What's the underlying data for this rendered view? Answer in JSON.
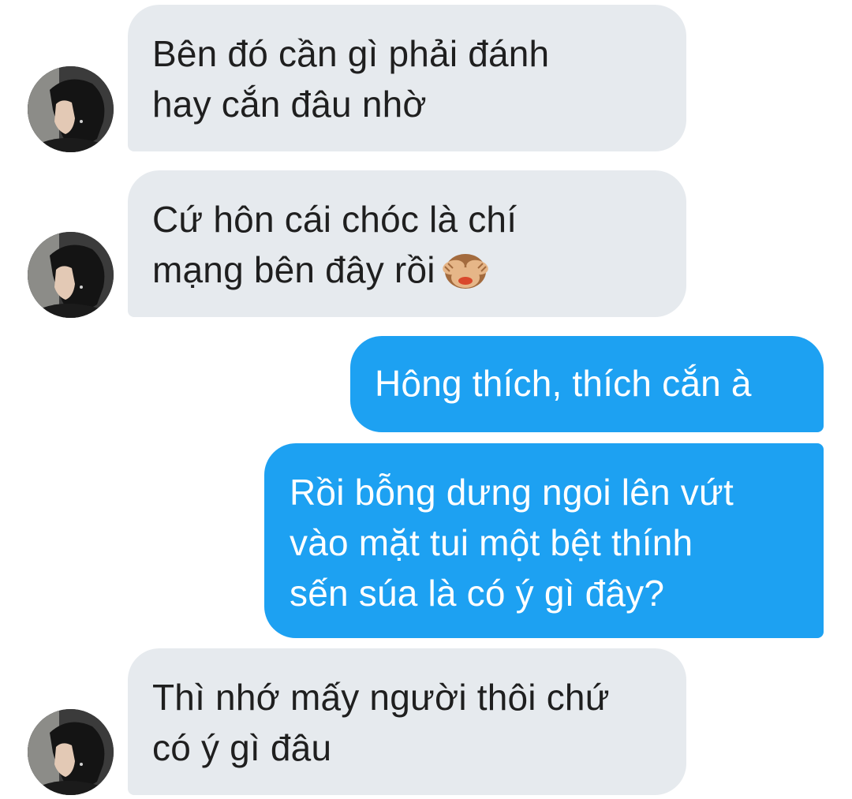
{
  "conversation": {
    "messages": [
      {
        "direction": "incoming",
        "lines": [
          "Bên đó cần gì phải đánh",
          "hay cắn đâu nhờ"
        ]
      },
      {
        "direction": "incoming",
        "lines": [
          "Cứ hôn cái chóc là chí",
          "mạng bên đây rồi"
        ],
        "emoji": "see-no-evil-monkey"
      },
      {
        "direction": "outgoing",
        "lines": [
          "Hông thích, thích cắn à"
        ]
      },
      {
        "direction": "outgoing",
        "lines": [
          "Rồi bỗng dưng ngoi lên vứt",
          "vào mặt tui một bệt thính",
          "sến súa là có ý gì đây?"
        ]
      },
      {
        "direction": "incoming",
        "lines": [
          "Thì nhớ mấy người thôi chứ",
          "có ý gì đâu"
        ]
      }
    ]
  },
  "colors": {
    "incoming_bubble": "#e6eaee",
    "outgoing_bubble": "#1da1f2",
    "incoming_text": "#1f1f1f",
    "outgoing_text": "#ffffff"
  }
}
